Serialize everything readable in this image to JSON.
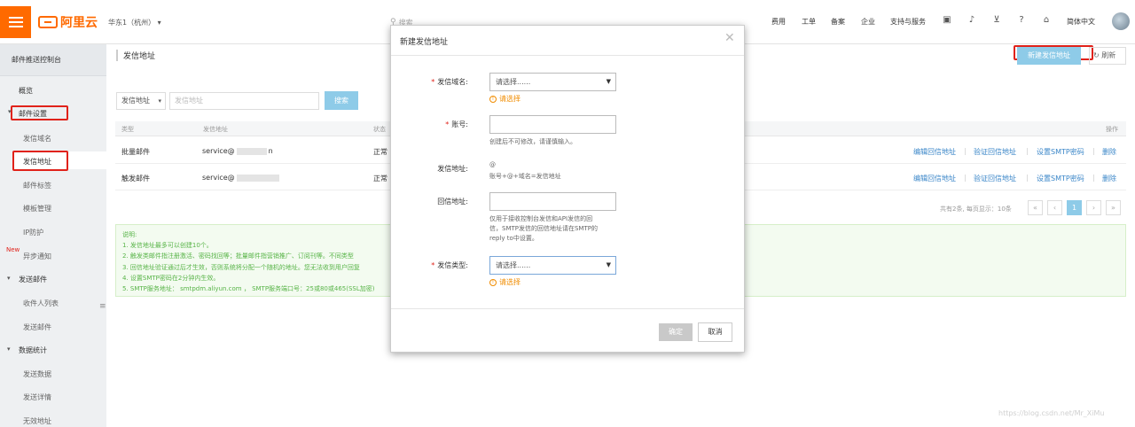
{
  "topbar": {
    "brand": "阿里云",
    "region": "华东1（杭州）",
    "search_placeholder": "搜索",
    "nav": [
      "费用",
      "工单",
      "备案",
      "企业",
      "支持与服务"
    ],
    "lang": "简体中文"
  },
  "sidebar": {
    "title": "邮件推送控制台",
    "items": {
      "overview": "概览",
      "mail_settings": "邮件设置",
      "sender_domain": "发信域名",
      "sender_address": "发信地址",
      "mail_tag": "邮件标签",
      "template": "模板管理",
      "ip_protect": "IP防护",
      "new_badge": "New",
      "async_notify": "异步通知",
      "send_mail": "发送邮件",
      "recipient_list": "收件人列表",
      "send_email": "发送邮件",
      "stats": "数据统计",
      "send_data": "发送数据",
      "send_detail": "发送详情",
      "invalid_addr": "无效地址"
    }
  },
  "main": {
    "page_title": "发信地址",
    "new_button": "新建发信地址",
    "refresh": "刷新",
    "filter": {
      "select": "发信地址",
      "placeholder": "发信地址",
      "search_button": "搜索"
    },
    "table": {
      "headers": [
        "类型",
        "发信地址",
        "状态",
        "操作"
      ],
      "rows": [
        {
          "type": "批量邮件",
          "address_prefix": "service@",
          "address_suffix": "n",
          "status": "正常"
        },
        {
          "type": "触发邮件",
          "address_prefix": "service@",
          "address_suffix": "",
          "status": "正常"
        }
      ],
      "actions": [
        "编辑回信地址",
        "验证回信地址",
        "设置SMTP密码",
        "删除"
      ]
    },
    "pager": {
      "summary": "共有2条, 每页显示：10条",
      "first": "«",
      "prev": "‹",
      "current": "1",
      "next": "›",
      "last": "»"
    },
    "notice": {
      "title": "说明:",
      "lines": [
        "1. 发信地址最多可以创建10个。",
        "2. 触发类邮件指注册激活、密码找回等；批量邮件指营销推广、订阅刊等。不同类型",
        "3. 回信地址验证通过后才生效，否则系统将分配一个随机的地址。您无法收到用户回复",
        "4. 设置SMTP密码在2分钟内生效。",
        "5. SMTP服务地址： smtpdm.aliyun.com ， SMTP服务端口号：25或80或465(SSL加密)"
      ]
    }
  },
  "modal": {
    "title": "新建发信地址",
    "domain_label": "发信域名:",
    "domain_value": "请选择......",
    "domain_error": "请选择",
    "account_label": "账号:",
    "account_value": "",
    "account_hint": "创建后不可修改，请谨慎输入。",
    "sender_label": "发信地址:",
    "sender_at": "@",
    "sender_formula": "账号+@+域名=发信地址",
    "reply_label": "回信地址:",
    "reply_value": "",
    "reply_hint": [
      "仅用于接收控制台发信和API发信的回",
      "信，SMTP发信的回信地址请在SMTP的",
      "reply to中设置。"
    ],
    "type_label": "发信类型:",
    "type_value": "请选择......",
    "type_error": "请选择",
    "ok": "确定",
    "cancel": "取消"
  },
  "watermark": "https://blog.csdn.net/Mr_XiMu",
  "colors": {
    "brand": "#ff6a00",
    "primary_btn": "#8ecbe8",
    "highlight": "#e0221a",
    "error": "#f08c00",
    "notice_text": "#58b448"
  }
}
